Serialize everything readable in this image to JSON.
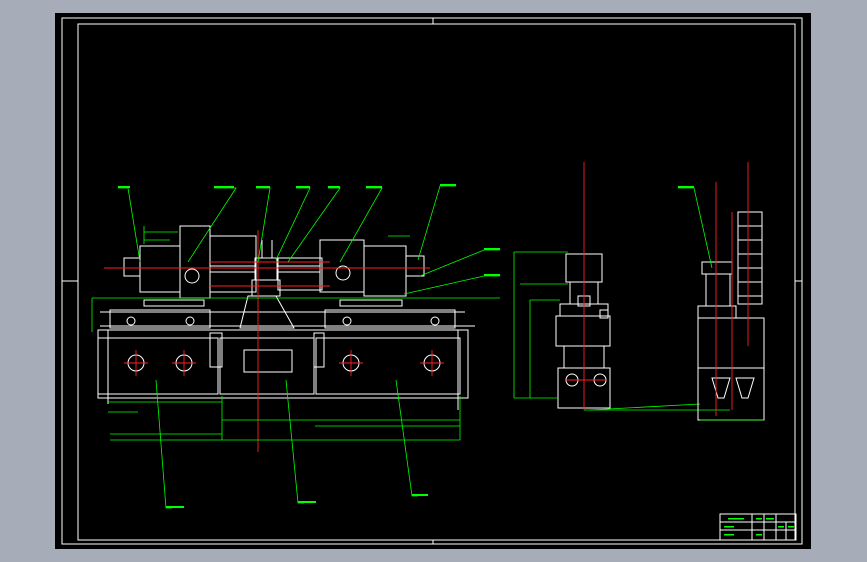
{
  "sheet": {
    "background": "#000000",
    "frame_color": "#ffffff",
    "dimension_color": "#00ff00",
    "centerline_color": "#ff2020",
    "surround_color": "#a6adb8"
  },
  "views": {
    "front": {
      "label": ""
    },
    "side": {
      "label": ""
    },
    "end": {
      "label": ""
    }
  },
  "title_block": {
    "label": ""
  }
}
